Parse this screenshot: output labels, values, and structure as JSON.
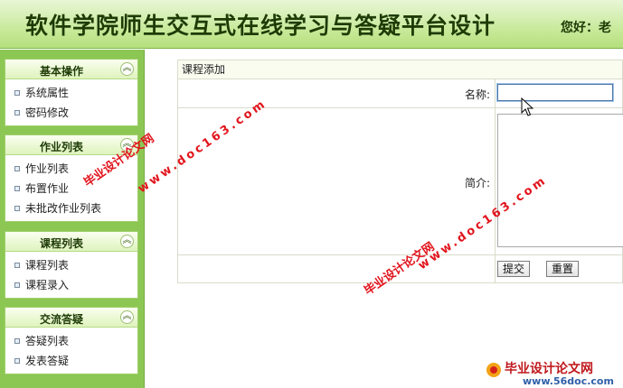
{
  "header": {
    "title": "软件学院师生交互式在线学习与答疑平台设计",
    "greeting": "您好：老"
  },
  "sidebar": {
    "panels": [
      {
        "title": "基本操作",
        "items": [
          "系统属性",
          "密码修改"
        ]
      },
      {
        "title": "作业列表",
        "items": [
          "作业列表",
          "布置作业",
          "未批改作业列表"
        ]
      },
      {
        "title": "课程列表",
        "items": [
          "课程列表",
          "课程录入"
        ]
      },
      {
        "title": "交流答疑",
        "items": [
          "答疑列表",
          "发表答疑"
        ]
      }
    ],
    "collapse_glyph": "︽"
  },
  "form": {
    "title": "课程添加",
    "name_label": "名称:",
    "name_value": "",
    "intro_label": "简介:",
    "intro_value": "",
    "submit_label": "提交",
    "reset_label": "重置"
  },
  "watermarks": {
    "site_cn": "毕业设计论文网",
    "site_url": "www.doc163.com",
    "logo_text": "毕业设计论文网",
    "logo_url": "www.56doc.com"
  },
  "colors": {
    "sidebar_bg": "#8cc754",
    "header_bg": "#c9ea9c",
    "watermark": "#e2141c"
  }
}
